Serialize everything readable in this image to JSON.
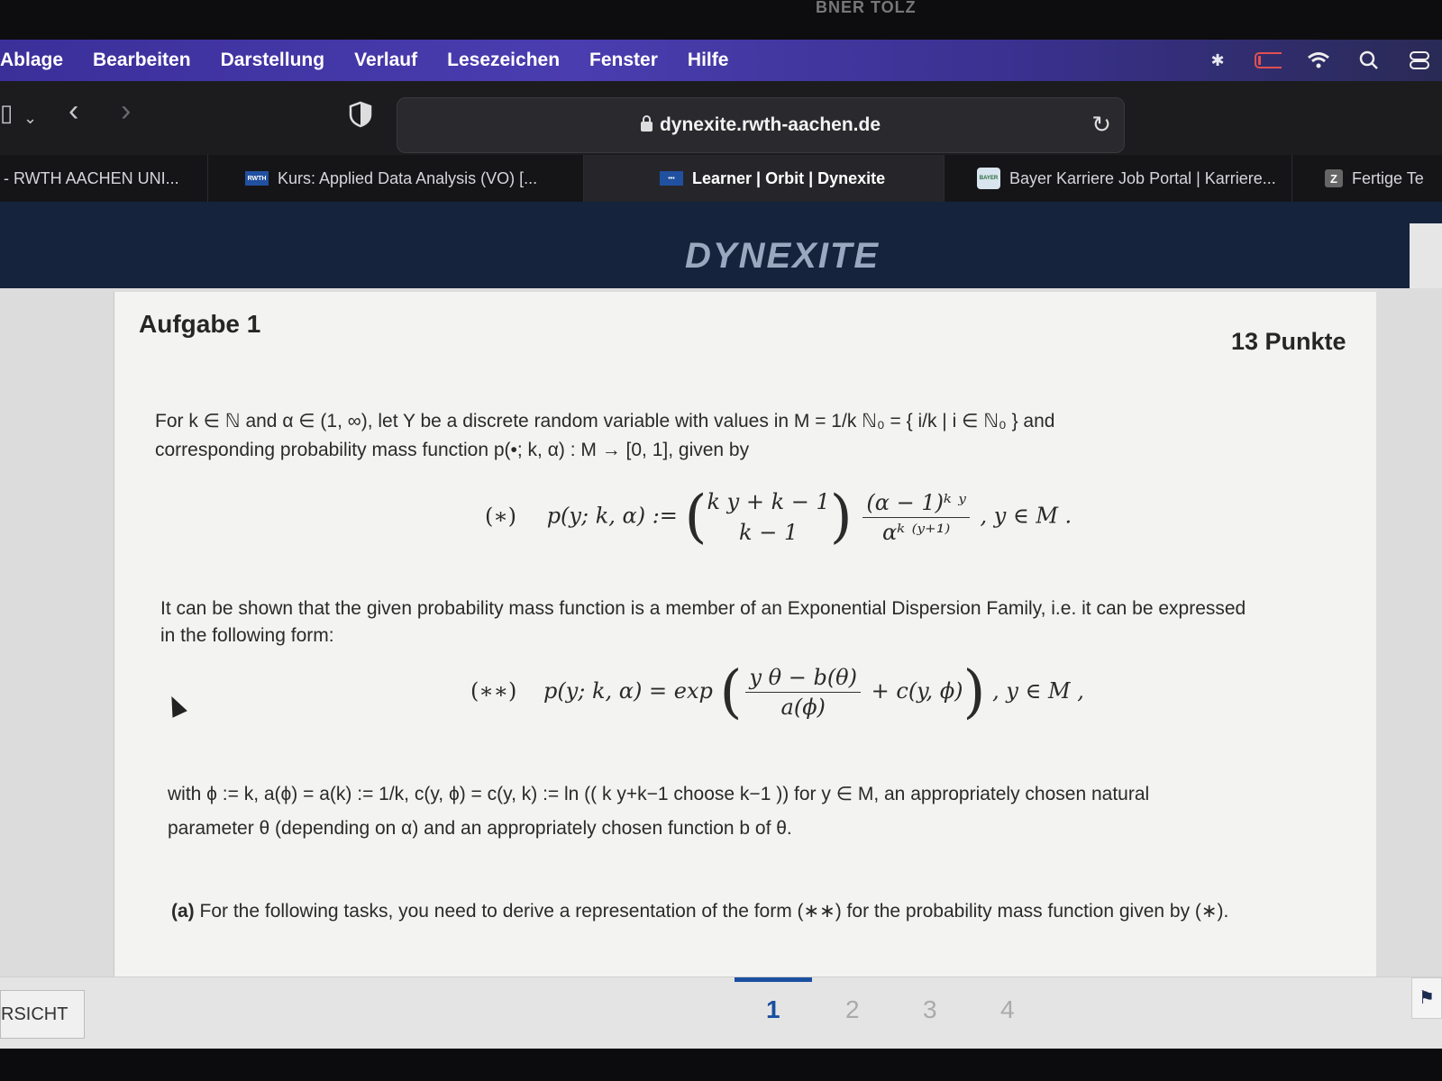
{
  "notch_text": "BNER TOLZ",
  "menubar": {
    "items": [
      "Ablage",
      "Bearbeiten",
      "Darstellung",
      "Verlauf",
      "Lesezeichen",
      "Fenster",
      "Hilfe"
    ]
  },
  "toolbar": {
    "address": "dynexite.rwth-aachen.de"
  },
  "tabs": [
    {
      "label": "- RWTH AACHEN UNI...",
      "favicon": ""
    },
    {
      "label": "Kurs: Applied Data Analysis (VO) [...",
      "favicon": "RWTH"
    },
    {
      "label": "Learner | Orbit | Dynexite",
      "favicon": "•••"
    },
    {
      "label": "Bayer Karriere Job Portal | Karriere...",
      "favicon": "BAYER"
    },
    {
      "label": "Fertige Te",
      "favicon": "Z"
    }
  ],
  "header": {
    "logo": "DYNEXITE"
  },
  "task": {
    "title": "Aufgabe 1",
    "points": "13 Punkte",
    "intro_1": "For k ∈ ℕ and α ∈ (1, ∞), let Y be a discrete random variable with values in M = 1/k ℕ₀ = { i/k | i ∈ ℕ₀ } and",
    "intro_2": "corresponding probability mass function p(•; k, α) : M → [0, 1], given by",
    "formula_1_label": "(∗)",
    "formula_1_lhs": "p(y; k, α) :=",
    "formula_1_binom_top": "k y + k − 1",
    "formula_1_binom_bottom": "k − 1",
    "formula_1_frac_num": "(α − 1)ᵏ ʸ",
    "formula_1_frac_den": "αᵏ ⁽ʸ⁺¹⁾",
    "formula_1_tail": ", y ∈ M .",
    "edf_1": "It can be shown that the given probability mass function is a member of an Exponential Dispersion Family, i.e. it can be expressed",
    "edf_2": "in the following form:",
    "formula_2_label": "(∗∗)",
    "formula_2_lhs": "p(y; k, α) = exp",
    "formula_2_frac_num": "y θ − b(θ)",
    "formula_2_frac_den": "a(ϕ)",
    "formula_2_plus": "+ c(y, ϕ)",
    "formula_2_tail": ", y ∈ M ,",
    "with_1": "with ϕ := k, a(ϕ) = a(k) := 1/k, c(y, ϕ) = c(y, k) := ln (( k y+k−1 choose k−1 )) for y ∈ M, an appropriately chosen natural",
    "with_2": "parameter θ (depending on α) and an appropriately chosen function b of θ.",
    "part_a_label": "(a)",
    "part_a_text": "For the following tasks, you need to derive a representation of the form (∗∗) for the probability mass function given by (∗)."
  },
  "bottom": {
    "overview_label": "RSICHT",
    "pages": [
      "1",
      "2",
      "3",
      "4"
    ],
    "active_page": "1"
  }
}
